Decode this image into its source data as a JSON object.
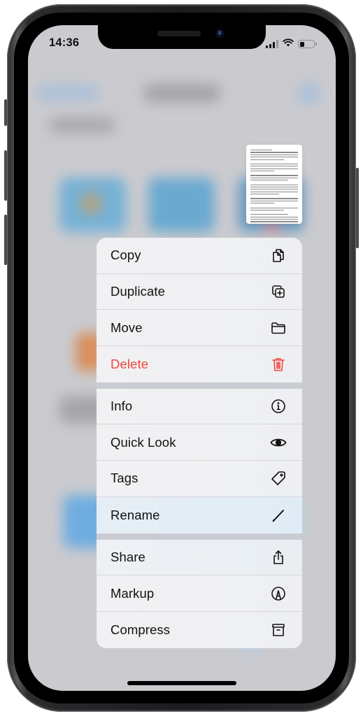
{
  "status_bar": {
    "time": "14:36",
    "signal_bars_active": 3,
    "signal_bars_total": 4,
    "wifi": "wifi-icon",
    "battery_level": 0.35
  },
  "preview": {
    "type": "document-thumbnail"
  },
  "context_menu": {
    "groups": [
      {
        "items": [
          {
            "label": "Copy",
            "icon": "copy-icon"
          },
          {
            "label": "Duplicate",
            "icon": "duplicate-icon"
          },
          {
            "label": "Move",
            "icon": "folder-icon"
          },
          {
            "label": "Delete",
            "icon": "trash-icon",
            "destructive": true,
            "color": "#f2463f"
          }
        ]
      },
      {
        "items": [
          {
            "label": "Info",
            "icon": "info-icon"
          },
          {
            "label": "Quick Look",
            "icon": "eye-icon"
          },
          {
            "label": "Tags",
            "icon": "tag-icon"
          },
          {
            "label": "Rename",
            "icon": "pencil-icon"
          }
        ]
      },
      {
        "items": [
          {
            "label": "Share",
            "icon": "share-icon"
          },
          {
            "label": "Markup",
            "icon": "markup-icon"
          },
          {
            "label": "Compress",
            "icon": "archive-icon"
          }
        ]
      }
    ]
  }
}
